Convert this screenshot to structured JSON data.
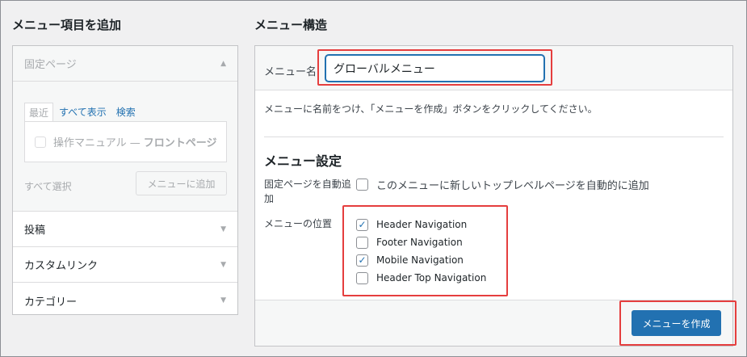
{
  "left": {
    "title": "メニュー項目を追加",
    "fixed_page": {
      "label": "固定ページ",
      "tabs": [
        "最近",
        "すべて表示",
        "検索"
      ],
      "item_label": "操作マニュアル — ",
      "item_suffix": "フロントページ",
      "select_all": "すべて選択",
      "add_button": "メニューに追加"
    },
    "sections": [
      {
        "label": "投稿"
      },
      {
        "label": "カスタムリンク"
      },
      {
        "label": "カテゴリー"
      }
    ]
  },
  "right": {
    "title": "メニュー構造",
    "name_label": "メニュー名",
    "name_value": "グローバルメニュー",
    "hint": "メニューに名前をつけ、「メニューを作成」ボタンをクリックしてください。",
    "settings_title": "メニュー設定",
    "auto_add_label": "固定ページを自動追加",
    "auto_add_text": "このメニューに新しいトップレベルページを自動的に追加",
    "auto_add_checked": false,
    "locations_label": "メニューの位置",
    "locations": [
      {
        "label": "Header Navigation",
        "checked": true
      },
      {
        "label": "Footer Navigation",
        "checked": false
      },
      {
        "label": "Mobile Navigation",
        "checked": true
      },
      {
        "label": "Header Top Navigation",
        "checked": false
      }
    ],
    "create_button": "メニューを作成"
  },
  "colors": {
    "accent": "#2271b1",
    "highlight": "#e53e3e"
  }
}
